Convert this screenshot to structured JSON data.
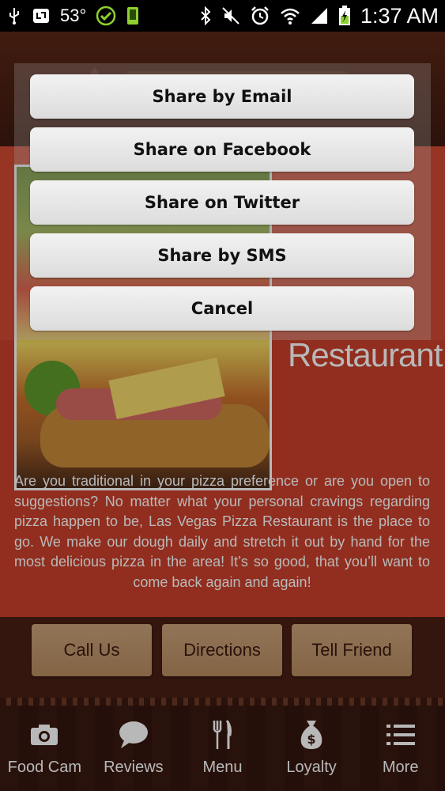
{
  "status_bar": {
    "temperature": "53°",
    "time": "1:37 AM"
  },
  "background": {
    "restaurant_word": "Restaurant",
    "description": "Are you traditional in your pizza preference or are you open to suggestions? No matter what your personal cravings regarding pizza happen to be, Las Vegas Pizza Restaurant is the place to go. We make our dough daily and stretch it out by hand for the most delicious pizza in the area! It’s so good, that you’ll want to come back again and again!",
    "actions": {
      "call_us": "Call Us",
      "directions": "Directions",
      "tell_friend": "Tell Friend"
    }
  },
  "tabs": [
    {
      "label": "Food Cam",
      "icon": "camera-icon"
    },
    {
      "label": "Reviews",
      "icon": "chat-bubble-icon"
    },
    {
      "label": "Menu",
      "icon": "fork-knife-icon"
    },
    {
      "label": "Loyalty",
      "icon": "money-bag-icon"
    },
    {
      "label": "More",
      "icon": "list-icon"
    }
  ],
  "share_dialog": {
    "email": "Share by Email",
    "facebook": "Share on Facebook",
    "twitter": "Share on Twitter",
    "sms": "Share by SMS",
    "cancel": "Cancel"
  },
  "colors": {
    "accent_red": "#d24a33",
    "dark_brown": "#3a1a10",
    "button_tan": "#c29a70"
  }
}
